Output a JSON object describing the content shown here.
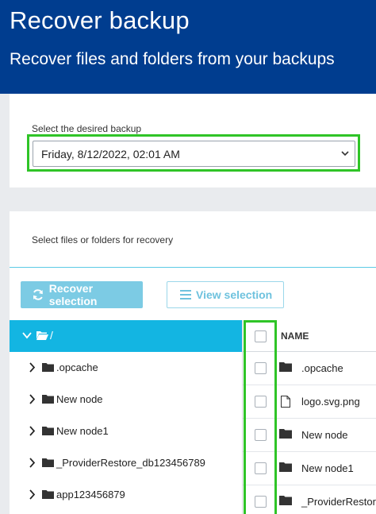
{
  "header": {
    "title": "Recover backup",
    "subtitle": "Recover files and folders from your backups"
  },
  "backup_select": {
    "label": "Select the desired backup",
    "value": "Friday, 8/12/2022, 02:01 AM"
  },
  "files_section": {
    "label": "Select files or folders for recovery",
    "recover_button": "Recover selection",
    "view_button": "View selection"
  },
  "tree": {
    "root": "/",
    "items": [
      {
        "label": ".opcache"
      },
      {
        "label": "New node"
      },
      {
        "label": "New node1"
      },
      {
        "label": "_ProviderRestore_db123456789"
      },
      {
        "label": "app123456879"
      }
    ]
  },
  "file_list": {
    "column_name": "NAME",
    "rows": [
      {
        "name": ".opcache",
        "icon": "folder-icon"
      },
      {
        "name": "logo.svg.png",
        "icon": "file-icon"
      },
      {
        "name": "New node",
        "icon": "folder-icon"
      },
      {
        "name": "New node1",
        "icon": "folder-icon"
      },
      {
        "name": "_ProviderRestore",
        "icon": "folder-icon"
      }
    ]
  },
  "colors": {
    "header_bg": "#003d8f",
    "accent": "#13b5e2",
    "highlight": "#2fc427"
  }
}
